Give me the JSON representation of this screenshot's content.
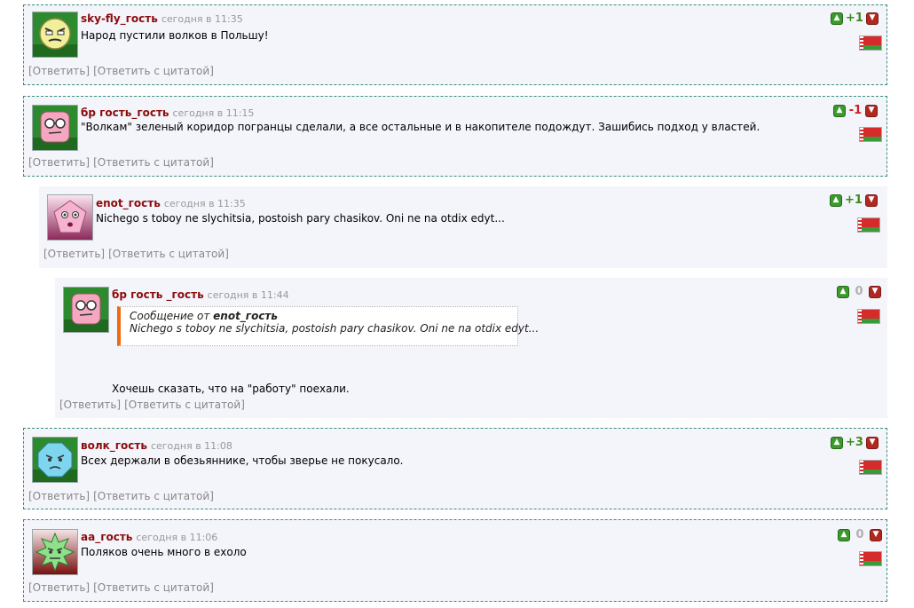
{
  "comments": [
    {
      "author": "sky-fly_гость",
      "time": "сегодня в 11:35",
      "text": "Народ пустили волков в Польшу!",
      "score": "+1",
      "score_color": "#3a8a1e",
      "reply": "[Ответить]",
      "reply_quote": "[Ответить с цитатой]",
      "avatar": "yellow-grumpy-face"
    },
    {
      "author": "бр гость_гость",
      "time": "сегодня в 11:15",
      "text": "\"Волкам\" зеленый коридор погранцы сделали, а все остальные и в накопителе подождут. Зашибись подход у властей.",
      "score": "-1",
      "score_color": "#cc1f1f",
      "reply": "[Ответить]",
      "reply_quote": "[Ответить с цитатой]",
      "avatar": "pink-glasses-face"
    },
    {
      "author": "enot_гость",
      "time": "сегодня в 11:35",
      "text": "Nichego s toboy ne slychitsia, postoish pary chasikov. Oni ne na otdix edyt...",
      "score": "+1",
      "score_color": "#3a8a1e",
      "reply": "[Ответить]",
      "reply_quote": "[Ответить с цитатой]",
      "avatar": "pink-pentagon-face"
    },
    {
      "author": "бр гость _гость",
      "time": "сегодня в 11:44",
      "quote_prefix": "Сообщение от ",
      "quote_author": "enot_гость",
      "quote_text": "Nichego s toboy ne slychitsia, postoish pary chasikov. Oni ne na otdix edyt...",
      "text": "Хочешь сказать, что на \"работу\" поехали.",
      "score": "0",
      "score_color": "#b0b0b0",
      "reply": "[Ответить]",
      "reply_quote": "[Ответить с цитатой]",
      "avatar": "pink-glasses-face"
    },
    {
      "author": "волк_гость",
      "time": "сегодня в 11:08",
      "text": "Всех держали в обезьяннике, чтобы зверье не покусало.",
      "score": "+3",
      "score_color": "#3a8a1e",
      "reply": "[Ответить]",
      "reply_quote": "[Ответить с цитатой]",
      "avatar": "blue-octagon-face"
    },
    {
      "author": "аа_гость",
      "time": "сегодня в 11:06",
      "text": "Поляков очень много в ехоло",
      "score": "0",
      "score_color": "#b0b0b0",
      "reply": "[Ответить]",
      "reply_quote": "[Ответить с цитатой]",
      "avatar": "green-spiky-face"
    }
  ],
  "icons": {
    "vote_up": "thumbs-up-icon",
    "vote_down": "thumbs-down-icon",
    "flag": "belarus-flag-icon"
  }
}
